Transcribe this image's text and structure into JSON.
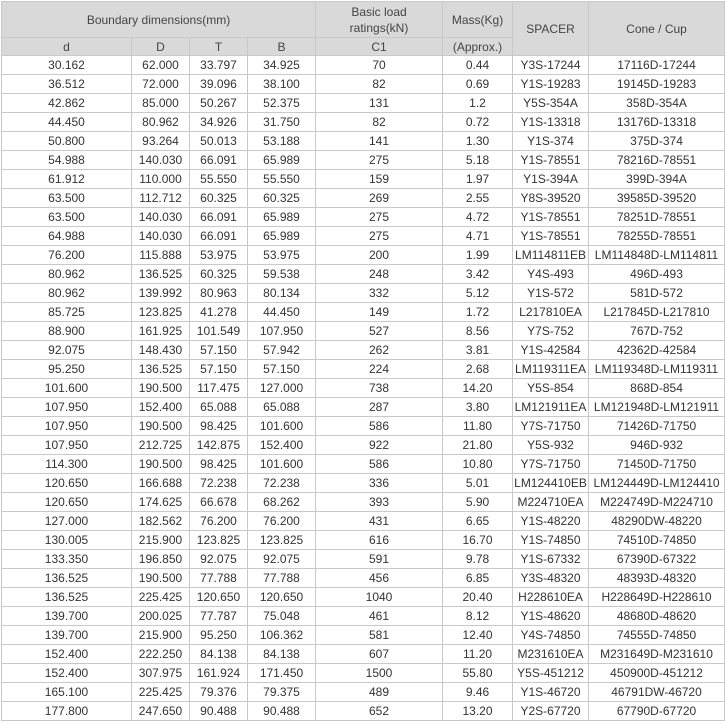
{
  "header": {
    "boundary_dimensions": "Boundary dimensions(mm)",
    "basic_load_ratings": "Basic load ratings(kN)",
    "mass": "Mass(Kg)",
    "spacer": "SPACER",
    "cone_cup": "Cone / Cup",
    "d": "d",
    "D": "D",
    "T": "T",
    "B": "B",
    "c1": "C1",
    "approx": "(Approx.)"
  },
  "rows": [
    [
      "30.162",
      "62.000",
      "33.797",
      "34.925",
      "70",
      "0.44",
      "Y3S-17244",
      "17116D-17244"
    ],
    [
      "36.512",
      "72.000",
      "39.096",
      "38.100",
      "82",
      "0.69",
      "Y1S-19283",
      "19145D-19283"
    ],
    [
      "42.862",
      "85.000",
      "50.267",
      "52.375",
      "131",
      "1.2",
      "Y5S-354A",
      "358D-354A"
    ],
    [
      "44.450",
      "80.962",
      "34.926",
      "31.750",
      "82",
      "0.72",
      "Y1S-13318",
      "13176D-13318"
    ],
    [
      "50.800",
      "93.264",
      "50.013",
      "53.188",
      "141",
      "1.30",
      "Y1S-374",
      "375D-374"
    ],
    [
      "54.988",
      "140.030",
      "66.091",
      "65.989",
      "275",
      "5.18",
      "Y1S-78551",
      "78216D-78551"
    ],
    [
      "61.912",
      "110.000",
      "55.550",
      "55.550",
      "159",
      "1.97",
      "Y1S-394A",
      "399D-394A"
    ],
    [
      "63.500",
      "112.712",
      "60.325",
      "60.325",
      "269",
      "2.55",
      "Y8S-39520",
      "39585D-39520"
    ],
    [
      "63.500",
      "140.030",
      "66.091",
      "65.989",
      "275",
      "4.72",
      "Y1S-78551",
      "78251D-78551"
    ],
    [
      "64.988",
      "140.030",
      "66.091",
      "65.989",
      "275",
      "4.71",
      "Y1S-78551",
      "78255D-78551"
    ],
    [
      "76.200",
      "115.888",
      "53.975",
      "53.975",
      "200",
      "1.99",
      "LM114811EB",
      "LM114848D-LM114811"
    ],
    [
      "80.962",
      "136.525",
      "60.325",
      "59.538",
      "248",
      "3.42",
      "Y4S-493",
      "496D-493"
    ],
    [
      "80.962",
      "139.992",
      "80.963",
      "80.134",
      "332",
      "5.12",
      "Y1S-572",
      "581D-572"
    ],
    [
      "85.725",
      "123.825",
      "41.278",
      "44.450",
      "149",
      "1.72",
      "L217810EA",
      "L217845D-L217810"
    ],
    [
      "88.900",
      "161.925",
      "101.549",
      "107.950",
      "527",
      "8.56",
      "Y7S-752",
      "767D-752"
    ],
    [
      "92.075",
      "148.430",
      "57.150",
      "57.942",
      "262",
      "3.81",
      "Y1S-42584",
      "42362D-42584"
    ],
    [
      "95.250",
      "136.525",
      "57.150",
      "57.150",
      "224",
      "2.68",
      "LM119311EA",
      "LM119348D-LM119311"
    ],
    [
      "101.600",
      "190.500",
      "117.475",
      "127.000",
      "738",
      "14.20",
      "Y5S-854",
      "868D-854"
    ],
    [
      "107.950",
      "152.400",
      "65.088",
      "65.088",
      "287",
      "3.80",
      "LM121911EA",
      "LM121948D-LM121911"
    ],
    [
      "107.950",
      "190.500",
      "98.425",
      "101.600",
      "586",
      "11.80",
      "Y7S-71750",
      "71426D-71750"
    ],
    [
      "107.950",
      "212.725",
      "142.875",
      "152.400",
      "922",
      "21.80",
      "Y5S-932",
      "946D-932"
    ],
    [
      "114.300",
      "190.500",
      "98.425",
      "101.600",
      "586",
      "10.80",
      "Y7S-71750",
      "71450D-71750"
    ],
    [
      "120.650",
      "166.688",
      "72.238",
      "72.238",
      "336",
      "5.01",
      "LM124410EB",
      "LM124449D-LM124410"
    ],
    [
      "120.650",
      "174.625",
      "66.678",
      "68.262",
      "393",
      "5.90",
      "M224710EA",
      "M224749D-M224710"
    ],
    [
      "127.000",
      "182.562",
      "76.200",
      "76.200",
      "431",
      "6.65",
      "Y1S-48220",
      "48290DW-48220"
    ],
    [
      "130.005",
      "215.900",
      "123.825",
      "123.825",
      "616",
      "16.70",
      "Y1S-74850",
      "74510D-74850"
    ],
    [
      "133.350",
      "196.850",
      "92.075",
      "92.075",
      "591",
      "9.78",
      "Y1S-67332",
      "67390D-67322"
    ],
    [
      "136.525",
      "190.500",
      "77.788",
      "77.788",
      "456",
      "6.85",
      "Y3S-48320",
      "48393D-48320"
    ],
    [
      "136.525",
      "225.425",
      "120.650",
      "120.650",
      "1040",
      "20.40",
      "H228610EA",
      "H228649D-H228610"
    ],
    [
      "139.700",
      "200.025",
      "77.787",
      "75.048",
      "461",
      "8.12",
      "Y1S-48620",
      "48680D-48620"
    ],
    [
      "139.700",
      "215.900",
      "95.250",
      "106.362",
      "581",
      "12.40",
      "Y4S-74850",
      "74555D-74850"
    ],
    [
      "152.400",
      "222.250",
      "84.138",
      "84.138",
      "607",
      "11.20",
      "M231610EA",
      "M231649D-M231610"
    ],
    [
      "152.400",
      "307.975",
      "161.924",
      "171.450",
      "1500",
      "55.80",
      "Y5S-451212",
      "450900D-451212"
    ],
    [
      "165.100",
      "225.425",
      "79.376",
      "79.375",
      "489",
      "9.46",
      "Y1S-46720",
      "46791DW-46720"
    ],
    [
      "177.800",
      "247.650",
      "90.488",
      "90.488",
      "652",
      "13.20",
      "Y2S-67720",
      "67790D-67720"
    ]
  ]
}
